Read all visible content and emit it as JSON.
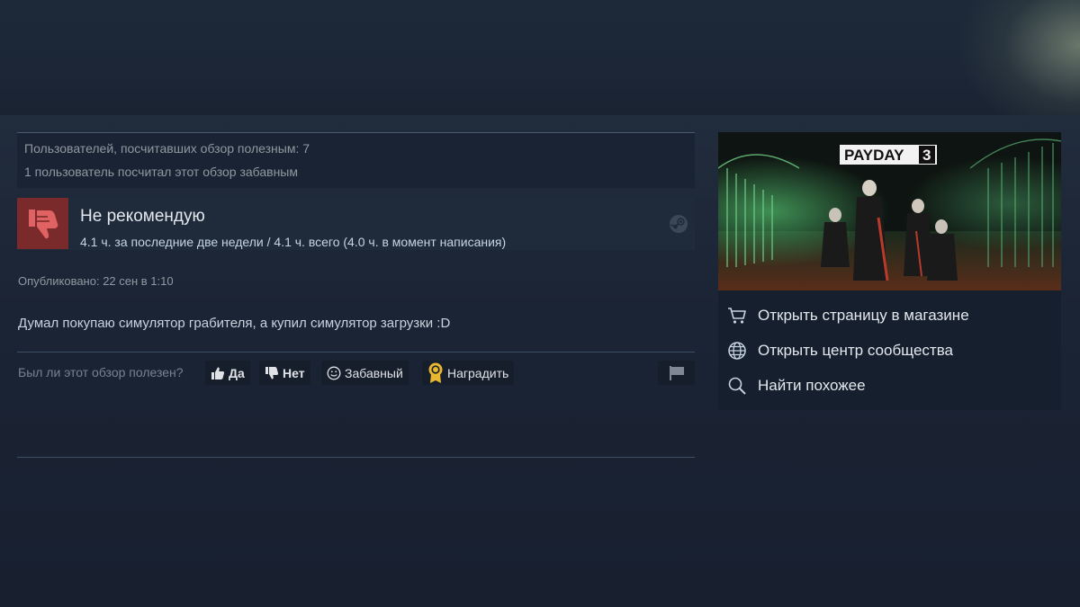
{
  "review": {
    "votes_helpful": "Пользователей, посчитавших обзор полезным: 7",
    "votes_funny": "1 пользователь посчитал этот обзор забавным",
    "rating_title": "Не рекомендую",
    "hours": "4.1 ч. за последние две недели / 4.1 ч. всего (4.0 ч. в момент написания)",
    "posted": "Опубликовано: 22 сен в 1:10",
    "text": "Думал покупаю симулятор грабителя, а купил симулятор загрузки :D"
  },
  "feedback": {
    "question": "Был ли этот обзор полезен?",
    "yes_label": "Да",
    "no_label": "Нет",
    "funny_label": "Забавный",
    "award_label": "Наградить"
  },
  "game": {
    "logo_text": "PAYDAY",
    "logo_number": "3"
  },
  "side_links": [
    {
      "label": "Открыть страницу в магазине",
      "icon": "cart-icon"
    },
    {
      "label": "Открыть центр сообщества",
      "icon": "globe-icon"
    },
    {
      "label": "Найти похожее",
      "icon": "search-icon"
    }
  ],
  "colors": {
    "background": "#1b2434",
    "not_recommended": "#7a2a2a",
    "award_gold": "#e8b730"
  }
}
